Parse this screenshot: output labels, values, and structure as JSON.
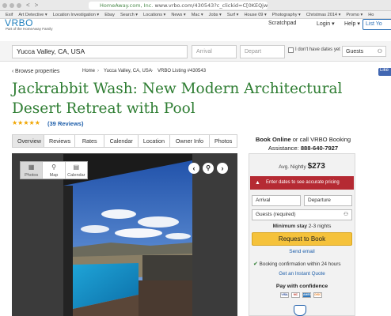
{
  "browser": {
    "nav_back": "<",
    "nav_forward": ">",
    "url_host": "HomeAway.com, Inc.",
    "url_rest": "www.vrbo.com/430543?c_clickid=C[0KEQjwmcTJBRCYWan",
    "bookmarks": [
      "Exif",
      "Art Detective ▾",
      "Location Investigation ▾",
      "Ebay",
      "Search ▾",
      "Locations ▾",
      "News ▾",
      "Mac ▾",
      "Jobs ▾",
      "Surf ▾",
      "House 09 ▾",
      "Photography ▾",
      "Christmas 2014 ▾",
      "Promo ▾",
      "Ho"
    ]
  },
  "header": {
    "logo": "VRBO",
    "logo_sub": "Part of the HomeAway Family",
    "links": [
      "Scratchpad",
      "Login ▾",
      "Help ▾"
    ],
    "list_button": "List Yo"
  },
  "search": {
    "location": "Yucca Valley, CA, USA",
    "arrival_placeholder": "Arrival",
    "depart_placeholder": "Depart",
    "no_dates_label": "I don't have dates yet",
    "guests_label": "Guests"
  },
  "breadcrumb": {
    "back": "Browse properties",
    "items": [
      "Home",
      "Yucca Valley, CA, USA",
      "VRBO Listing #430543"
    ]
  },
  "listing": {
    "title": "Jackrabbit Wash: New Modern Architectural Desert Retreat with Pool",
    "stars": "★★★★★",
    "rating": 5,
    "reviews_count": "39",
    "reviews_label": "Reviews",
    "tabs": [
      "Overview",
      "Reviews",
      "Rates",
      "Calendar",
      "Location",
      "Owner Info",
      "Photos"
    ]
  },
  "gallery": {
    "tools": [
      "Photos",
      "Map",
      "Calendar"
    ],
    "tool_icons": [
      "▦",
      "⚲",
      "▤"
    ]
  },
  "booking": {
    "book_online": "Book Online",
    "call_text": "or call VRBO Booking Assistance:",
    "phone": "888-640-7927",
    "avg_label": "Avg. Nightly",
    "price": "$273",
    "alert": "Enter dates to see accurate pricing",
    "arrival": "Arrival",
    "departure": "Departure",
    "guests": "Guests (required)",
    "min_stay_label": "Minimum stay",
    "min_stay_value": "2-3 nights",
    "request_button": "Request to Book",
    "send_email": "Send email",
    "confirmation": "Booking confirmation within 24 hours",
    "instant_quote": "Get an Instant Quote",
    "pay_confidence": "Pay with confidence",
    "cards": [
      "VISA",
      "MC",
      "AMEX",
      "DISC"
    ]
  },
  "social": {
    "fb_like": "Like"
  }
}
